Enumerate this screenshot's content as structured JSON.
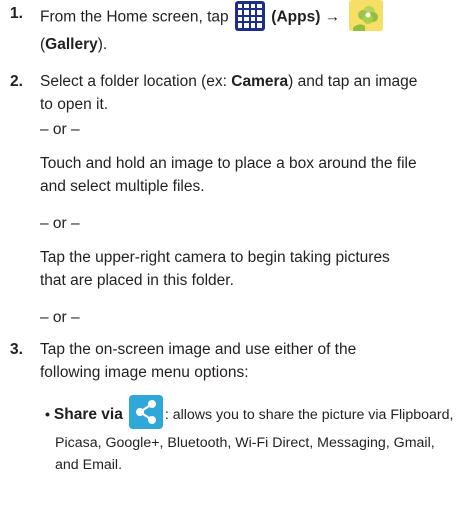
{
  "steps": [
    {
      "number": "1.",
      "line1_pre": "From the Home screen, tap",
      "apps_label": "(Apps)",
      "arrow": "→",
      "line2_pre": "(",
      "gallery_label": "Gallery",
      "line2_post": ")."
    },
    {
      "number": "2.",
      "line1_pre": "Select a folder location (ex: ",
      "camera_label": "Camera",
      "line1_post": ") and tap an image",
      "line2": "to open it."
    },
    {
      "number": "3.",
      "line1": "Tap the on-screen image and use either of the",
      "line2": "following image menu options:"
    }
  ],
  "or_separator": "– or –",
  "para_touch_hold": {
    "line1": "Touch and hold an image to place a box around the file",
    "line2": "and select multiple files."
  },
  "para_camera": {
    "line1": "Tap the upper-right camera to begin taking pictures",
    "line2": "that are placed in this folder."
  },
  "bullet": {
    "marker": "•",
    "label": "Share via",
    "line1_post": ": allows you to share the picture via Flipboard,",
    "line2": "Picasa, Google+, Bluetooth, Wi-Fi Direct, Messaging, Gmail,",
    "line3": "and Email."
  },
  "icons": {
    "apps": "apps-grid-icon",
    "gallery": "gallery-flower-icon",
    "share": "share-icon"
  },
  "colors": {
    "apps_icon": "#1b2e8e",
    "share_icon": "#2ea7d9",
    "gallery_bg": "#f6d84a",
    "gallery_flower": "#8fbf3c"
  }
}
